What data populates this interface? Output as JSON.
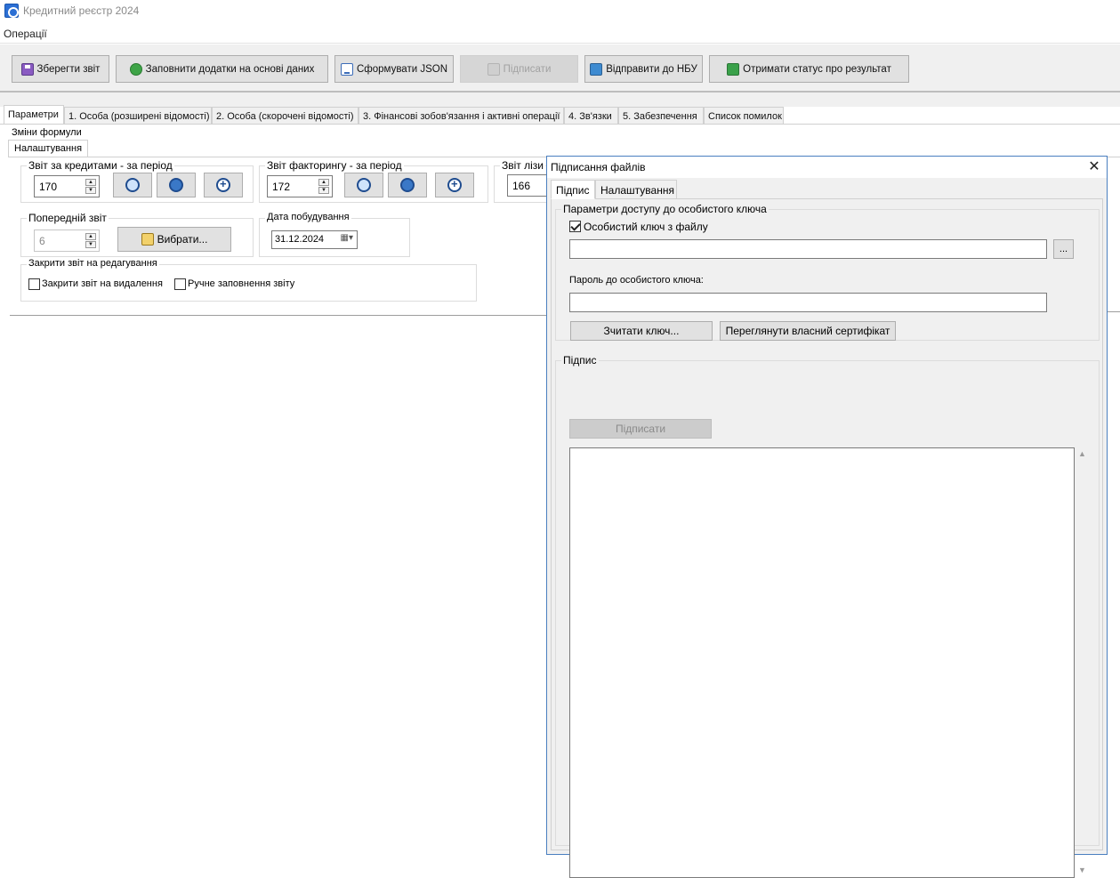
{
  "window": {
    "title": "Кредитний реєстр 2024"
  },
  "menu": {
    "operations": "Операції"
  },
  "toolbar": {
    "save": "Зберегти звіт",
    "fill": "Заповнити додатки на основі даних",
    "json": "Сформувати JSON",
    "sign": "Підписати",
    "send": "Відправити до НБУ",
    "status": "Отримати статус про результат"
  },
  "tabs": [
    "Параметри",
    "1. Особа (розширені відомості)",
    "2. Особа (скорочені відомості)",
    "3. Фінансові зобов'язання і активні операції",
    "4. Зв'язки",
    "5. Забезпечення",
    "Список помилок"
  ],
  "params": {
    "formula_label": "Зміни формули",
    "subtab": "Налаштування",
    "credits": {
      "label": "Звіт за кредитами - за період",
      "value": "170"
    },
    "factoring": {
      "label": "Звіт факторингу - за період",
      "value": "172"
    },
    "leasing": {
      "label": "Звіт лізи",
      "value": "166"
    },
    "previous": {
      "label": "Попередній звіт",
      "value": "6",
      "button": "Вибрати..."
    },
    "build_date": {
      "label": "Дата побудування",
      "value": "31.12.2024"
    },
    "close_editing": {
      "label": "Закрити звіт на редагування",
      "close_delete": "Закрити звіт на видалення",
      "manual_fill": "Ручне заповнення звіту"
    }
  },
  "dialog": {
    "title": "Підписання файлів",
    "tabs": [
      "Підпис",
      "Налаштування"
    ],
    "key_group": "Параметри доступу до особистого ключа",
    "key_from_file": "Особистий ключ з файлу",
    "key_from_file_checked": true,
    "browse": "...",
    "password_label": "Пароль до особистого ключа:",
    "read_key": "Зчитати ключ...",
    "view_cert": "Переглянути власний сертифікат",
    "sign_group": "Підпис",
    "sign_button": "Підписати"
  }
}
